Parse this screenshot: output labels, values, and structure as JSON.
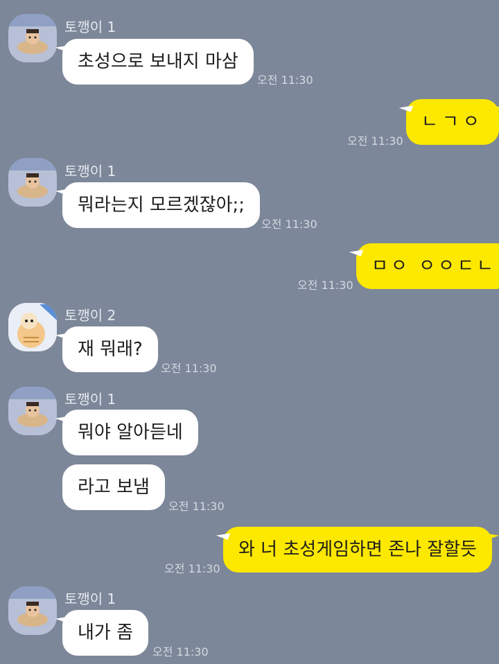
{
  "messages": [
    {
      "sender": "토깽이 1",
      "text": "초성으로 보내지 마삼",
      "time": "오전 11:30"
    },
    {
      "sender": "me",
      "text": "ㄴㄱㅇ",
      "time": "오전 11:30"
    },
    {
      "sender": "토깽이 1",
      "text": "뭐라는지 모르겠잖아;;",
      "time": "오전 11:30"
    },
    {
      "sender": "me",
      "text": "ㅁㅇ ㅇㅇㄷㄴ",
      "time": "오전 11:30"
    },
    {
      "sender": "토깽이 2",
      "text": "재 뭐래?",
      "time": "오전 11:30"
    },
    {
      "sender": "토깽이 1",
      "text": "뭐야 알아듣네",
      "time": ""
    },
    {
      "sender": "토깽이 1",
      "text": "라고 보냄",
      "time": "오전 11:30"
    },
    {
      "sender": "me",
      "text": "와 너 초성게임하면 존나 잘할듯",
      "time": "오전 11:30"
    },
    {
      "sender": "토깽이 1",
      "text": "내가 좀",
      "time": "오전 11:30"
    }
  ],
  "colors": {
    "background": "#7c8799",
    "my_bubble": "#fde800",
    "their_bubble": "#ffffff"
  },
  "icons": {
    "avatar_1": "bear-in-boat-avatar-icon",
    "avatar_2": "cartoon-character-avatar-icon"
  }
}
